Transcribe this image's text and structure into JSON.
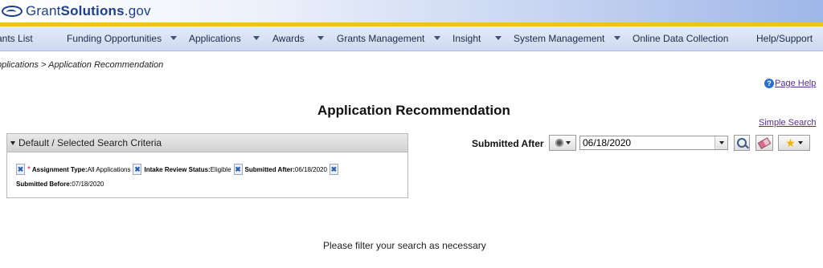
{
  "logo": {
    "text_plain": "Grant",
    "text_bold": "Solutions",
    "text_suffix": ".gov"
  },
  "nav": {
    "items": [
      {
        "label": "ants List"
      },
      {
        "label": "Funding Opportunities"
      },
      {
        "label": "Applications"
      },
      {
        "label": "Awards"
      },
      {
        "label": "Grants Management"
      },
      {
        "label": "Insight"
      },
      {
        "label": "System Management"
      },
      {
        "label": "Online Data Collection"
      },
      {
        "label": "Help/Support"
      }
    ]
  },
  "breadcrumb": "pplications > Application Recommendation",
  "page_help": "Page Help",
  "page_title": "Application Recommendation",
  "simple_search": "Simple Search",
  "criteria": {
    "header": "Default / Selected Search Criteria",
    "required_mark": "*",
    "items": [
      {
        "label": "Assignment Type:",
        "value": "All Applications"
      },
      {
        "label": "Intake Review Status:",
        "value": "Eligible"
      },
      {
        "label": "Submitted After:",
        "value": "06/18/2020"
      },
      {
        "label": "Submitted Before:",
        "value": "07/18/2020"
      }
    ],
    "remove_glyph": "✖"
  },
  "search": {
    "field_label": "Submitted After",
    "date_value": "06/18/2020",
    "star_glyph": "★"
  },
  "filter_message": "Please filter your search as necessary",
  "colors": {
    "banner_gold": "#f3c21a",
    "nav_bg": "#cdd9f0",
    "link": "#5a2d91",
    "logo_blue": "#1f3f8a"
  }
}
